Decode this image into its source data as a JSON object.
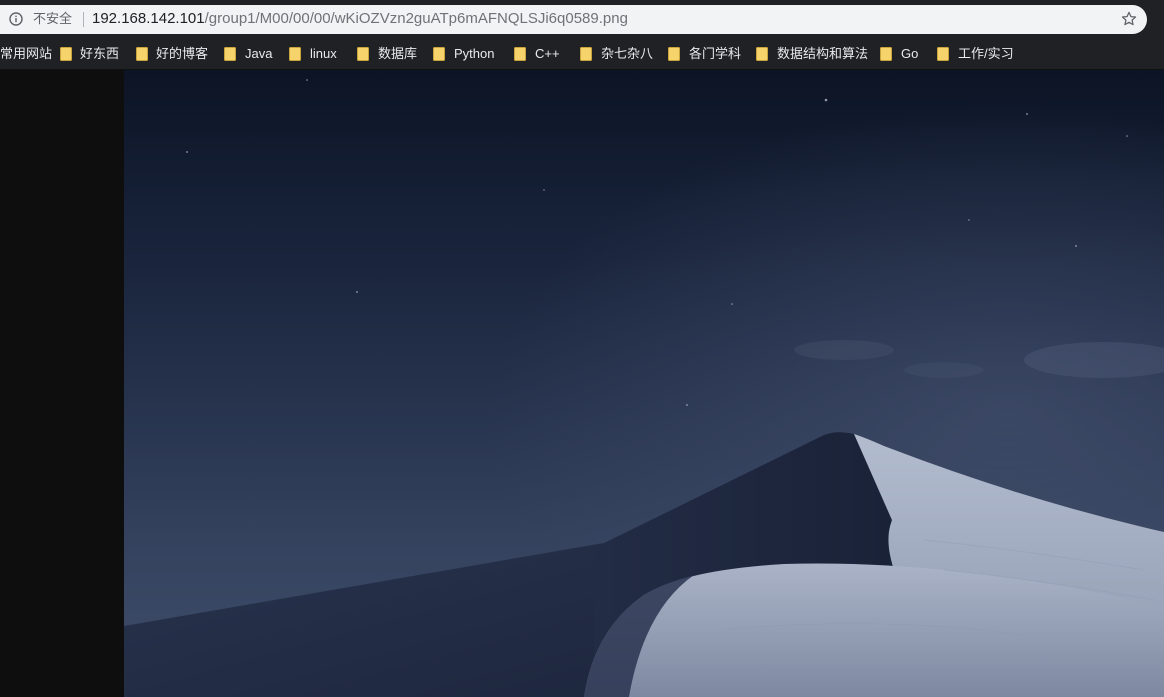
{
  "address_bar": {
    "security_label": "不安全",
    "url_host": "192.168.142.101",
    "url_path": "/group1/M00/00/00/wKiOZVzn2guATp6mAFNQLSJi6q0589.png"
  },
  "bookmarks": [
    {
      "label": "常用网站",
      "icon": "folder-icon"
    },
    {
      "label": "好东西",
      "icon": "folder-icon"
    },
    {
      "label": "好的博客",
      "icon": "folder-icon"
    },
    {
      "label": "Java",
      "icon": "folder-icon"
    },
    {
      "label": "linux",
      "icon": "folder-icon"
    },
    {
      "label": "数据库",
      "icon": "folder-icon"
    },
    {
      "label": "Python",
      "icon": "folder-icon"
    },
    {
      "label": "C++",
      "icon": "folder-icon"
    },
    {
      "label": "杂七杂八",
      "icon": "folder-icon"
    },
    {
      "label": "各门学科",
      "icon": "folder-icon"
    },
    {
      "label": "数据结构和算法",
      "icon": "folder-icon"
    },
    {
      "label": "Go",
      "icon": "folder-icon"
    },
    {
      "label": "工作/实习",
      "icon": "folder-icon"
    }
  ],
  "image": {
    "subject": "night desert sand dunes wallpaper"
  },
  "colors": {
    "toolbar_bg": "#202124",
    "omnibox_bg": "#f1f3f4",
    "folder_yellow": "#f6d36b",
    "page_bg": "#0e0e0e",
    "sky_top": "#0d1526",
    "sky_bottom": "#3d4b66",
    "dune_light": "#9ba6bd",
    "dune_shadow": "#222c44"
  }
}
